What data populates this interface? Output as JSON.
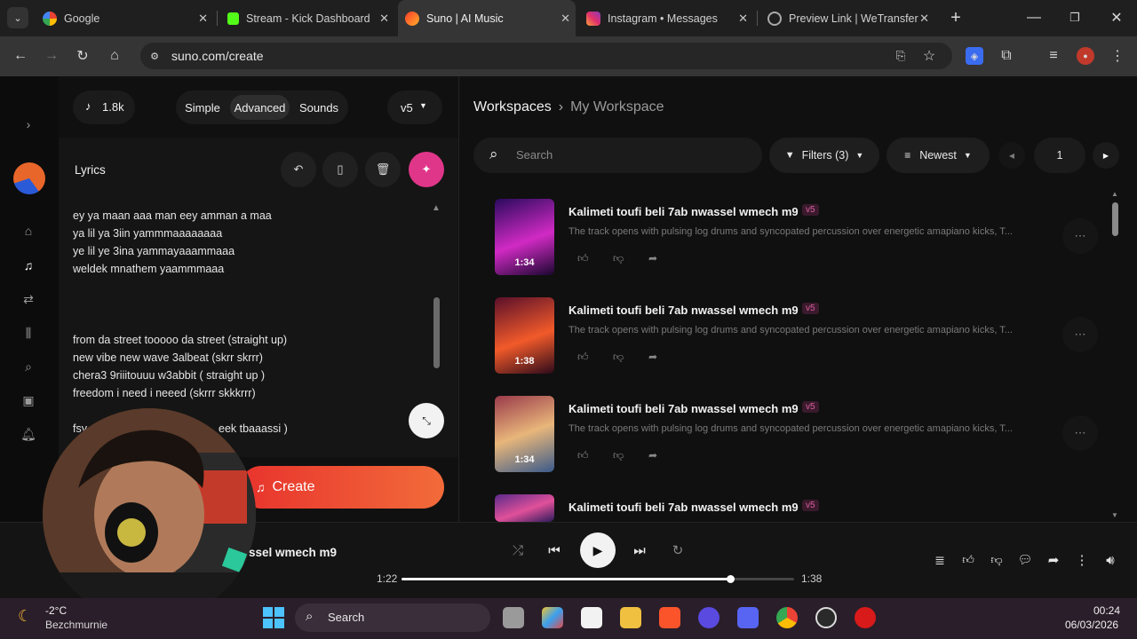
{
  "browser": {
    "tabs": [
      {
        "title": "Google",
        "color": "#4285f4"
      },
      {
        "title": "Stream - Kick Dashboard",
        "color": "#53fc18"
      },
      {
        "title": "Suno | AI Music",
        "color": "#ff5a36"
      },
      {
        "title": "Instagram • Messages",
        "color": "#e1306c"
      },
      {
        "title": "Preview Link | WeTransfer",
        "color": "#9a9a9a"
      }
    ],
    "close_glyph": "✕",
    "new_tab_glyph": "+",
    "url": "suno.com/create"
  },
  "create": {
    "credits": "1.8k",
    "modes": [
      "Simple",
      "Advanced",
      "Sounds"
    ],
    "active_mode": "Advanced",
    "version": "v5",
    "lyrics_label": "Lyrics",
    "lyrics_lines": [
      "ey ya maan aaa man eey amman a maa",
      "ya lil ya 3iin yammmaaaaaaaa",
      "ye lil ye 3ina yammayaaammaaa",
      "weldek mnathem yaammmaaa",
      "from da street tooooo da street   (straight up)",
      "new vibe new wave 3albeat (skrr skrrr)",
      "chera3 9riiitouuu w3abbit  ( straight up )",
      "freedom i need i neeed  (skrrr skkkrrr)",
      "fsy",
      "eek tbaaassi )"
    ],
    "create_button": "Create"
  },
  "workspace": {
    "breadcrumb_root": "Workspaces",
    "breadcrumb_current": "My Workspace",
    "search_placeholder": "Search",
    "filters_label": "Filters (3)",
    "sort_label": "Newest",
    "page_number": "1",
    "songs": [
      {
        "title": "Kalimeti toufi beli 7ab nwassel wmech m9",
        "tag": "v5",
        "desc": "The track opens with pulsing log drums and syncopated percussion over energetic amapiano kicks, T...",
        "duration": "1:34",
        "palette": [
          "#2a0a5e",
          "#d12ac4",
          "#1a0730"
        ]
      },
      {
        "title": "Kalimeti toufi beli 7ab nwassel wmech m9",
        "tag": "v5",
        "desc": "The track opens with pulsing log drums and syncopated percussion over energetic amapiano kicks, T...",
        "duration": "1:38",
        "palette": [
          "#5a0f2a",
          "#f25a2a",
          "#2c0a1a"
        ]
      },
      {
        "title": "Kalimeti toufi beli 7ab nwassel wmech m9",
        "tag": "v5",
        "desc": "The track opens with pulsing log drums and syncopated percussion over energetic amapiano kicks, T...",
        "duration": "1:34",
        "palette": [
          "#9a3a4a",
          "#e8b67a",
          "#3a5a8a"
        ]
      },
      {
        "title": "Kalimeti toufi beli 7ab nwassel wmech m9",
        "tag": "v5",
        "desc": "",
        "duration": "",
        "palette": [
          "#5a2a8a",
          "#e0509a",
          "#2a1a5a"
        ]
      }
    ]
  },
  "player": {
    "track_title": "ssel wmech m9",
    "elapsed": "1:22",
    "total": "1:38",
    "progress_fraction": 0.837
  },
  "taskbar": {
    "weather_temp": "-2°C",
    "weather_location": "Bezchmurnie",
    "search_label": "Search",
    "time": "00:24",
    "date": "06/03/2026"
  },
  "colors": {
    "accent": "#e0368a",
    "create_gradient_start": "#e8332d",
    "create_gradient_end": "#f26b3a"
  }
}
